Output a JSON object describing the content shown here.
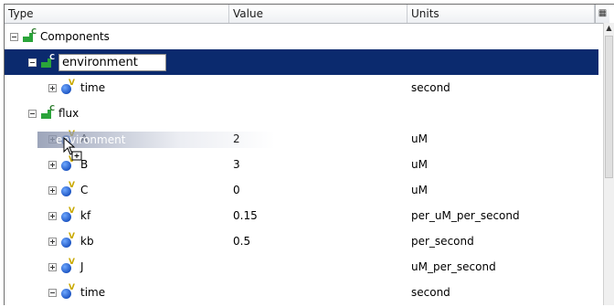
{
  "columns": {
    "type": "Type",
    "value": "Value",
    "units": "Units"
  },
  "corner_icon": "column-chooser-icon",
  "rows": [
    {
      "name": "Components",
      "value": "",
      "units": ""
    },
    {
      "name": "environment",
      "value": "",
      "units": ""
    },
    {
      "name": "time",
      "value": "",
      "units": "second"
    },
    {
      "name": "flux",
      "value": "",
      "units": ""
    },
    {
      "name": "A",
      "value": "2",
      "units": "uM"
    },
    {
      "name": "B",
      "value": "3",
      "units": "uM"
    },
    {
      "name": "C",
      "value": "0",
      "units": "uM"
    },
    {
      "name": "kf",
      "value": "0.15",
      "units": "per_uM_per_second"
    },
    {
      "name": "kb",
      "value": "0.5",
      "units": "per_second"
    },
    {
      "name": "J",
      "value": "",
      "units": "uM_per_second"
    },
    {
      "name": "time",
      "value": "",
      "units": "second"
    }
  ],
  "drag_ghost_label": "environment",
  "colors": {
    "selection": "#0b2a6e",
    "component_icon": "#2aa43a",
    "variable_icon": "#1f57c4"
  }
}
